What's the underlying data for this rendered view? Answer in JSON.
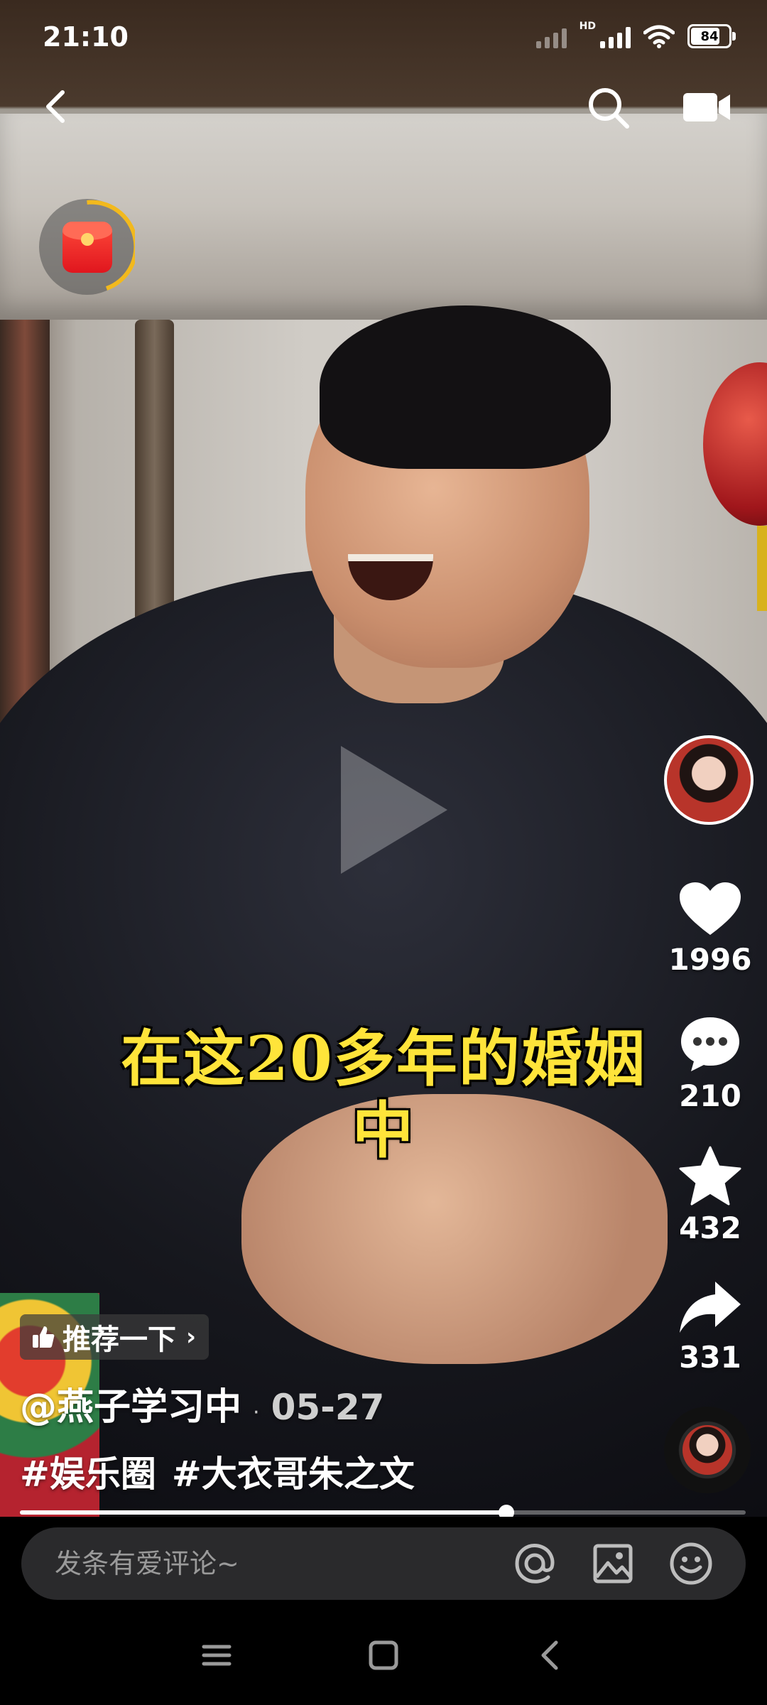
{
  "status_bar": {
    "time": "21:10",
    "network": "HD",
    "battery": "84"
  },
  "video": {
    "subtitle_line1": "在这20多年的婚姻",
    "subtitle_line2": "中",
    "progress_fraction": 0.67
  },
  "actions": {
    "likes": "1996",
    "comments": "210",
    "favorites": "432",
    "shares": "331"
  },
  "info": {
    "recommend_label": "推荐一下",
    "author": "@燕子学习中",
    "separator": "·",
    "date": "05-27",
    "tags": [
      "#娱乐圈",
      "#大衣哥朱之文"
    ]
  },
  "comment": {
    "placeholder": "发条有爱评论~"
  },
  "icons": {
    "back": "back-arrow-icon",
    "search": "search-icon",
    "camera": "video-camera-icon",
    "red_packet": "red-packet-icon",
    "play": "play-icon",
    "like": "heart-icon",
    "comment": "comment-bubble-icon",
    "favorite": "star-icon",
    "share": "share-arrow-icon",
    "mention": "at-icon",
    "image": "image-icon",
    "emoji": "emoji-icon",
    "nav_menu": "menu-icon",
    "nav_home": "home-square-icon",
    "nav_back": "nav-back-icon"
  },
  "colors": {
    "subtitle": "#ffe43a",
    "accent_ring": "#f2b91d"
  }
}
